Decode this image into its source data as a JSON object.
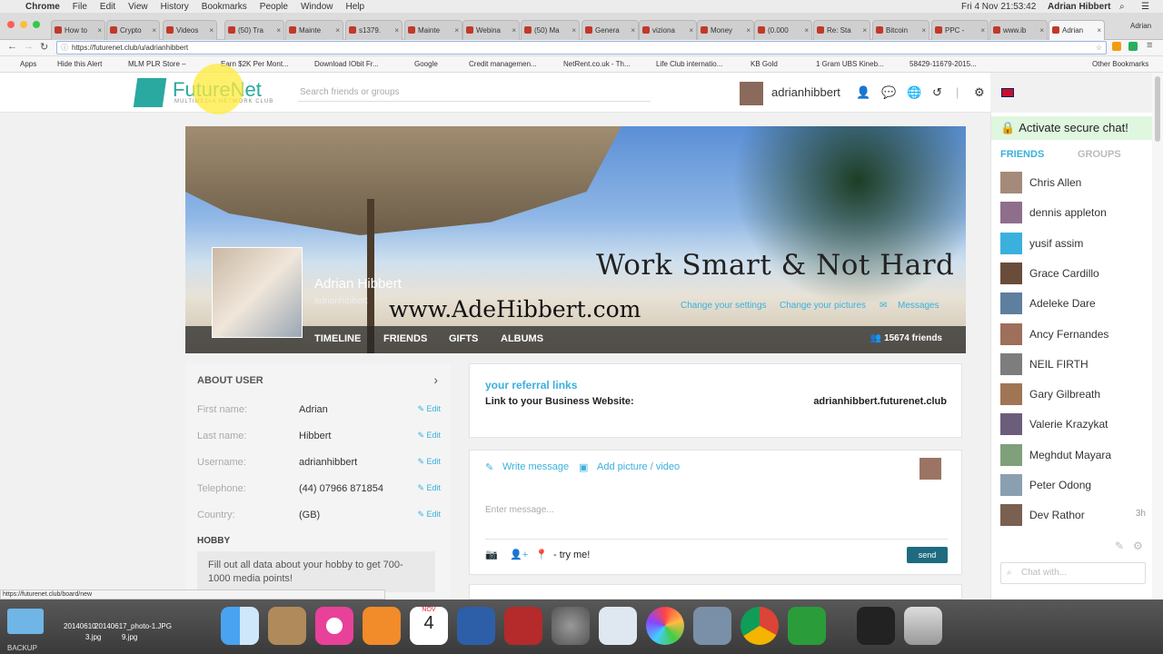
{
  "menubar": {
    "app": "Chrome",
    "items": [
      "File",
      "Edit",
      "View",
      "History",
      "Bookmarks",
      "People",
      "Window",
      "Help"
    ],
    "clock": "Fri 4 Nov  21:53:42",
    "user": "Adrian Hibbert"
  },
  "tabs": [
    {
      "label": "How to"
    },
    {
      "label": "Crypto"
    },
    {
      "label": "Videos"
    },
    {
      "label": "(50) Tra"
    },
    {
      "label": "Mainte"
    },
    {
      "label": "s1379."
    },
    {
      "label": "Mainte"
    },
    {
      "label": "Webina"
    },
    {
      "label": "(50) Ma"
    },
    {
      "label": "Genera"
    },
    {
      "label": "viziona"
    },
    {
      "label": "Money"
    },
    {
      "label": "(0.000"
    },
    {
      "label": "Re: Sta"
    },
    {
      "label": "Bitcoin"
    },
    {
      "label": "PPC -"
    },
    {
      "label": "www.ib"
    },
    {
      "label": "Adrian"
    }
  ],
  "window_user_tab": "Adrian",
  "address": {
    "url": "https://futurenet.club/u/adrianhibbert"
  },
  "bookmarks": [
    "Apps",
    "Hide this Alert",
    "MLM PLR Store –",
    "Earn $2K Per Mont...",
    "Download IObit Fr...",
    "Google",
    "Credit managemen...",
    "NetRent.co.uk - Th...",
    "Life Club internatio...",
    "KB Gold",
    "1 Gram UBS Kineb...",
    "58429-11679-2015...",
    "Other Bookmarks"
  ],
  "header": {
    "logo": "FutureNet",
    "logo_sub": "MULTIMEDIA NETWORK CLUB",
    "search_placeholder": "Search friends or groups",
    "username": "adrianhibbert"
  },
  "cover": {
    "tagline": "Work Smart & Not Hard",
    "website": "www.AdeHibbert.com",
    "profile_name": "Adrian Hibbert",
    "profile_username": "adrianhibbert",
    "links": {
      "settings": "Change your settings",
      "pictures": "Change your pictures",
      "messages": "Messages"
    },
    "nav": [
      "TIMELINE",
      "FRIENDS",
      "GIFTS",
      "ALBUMS"
    ],
    "friends_count": "15674 friends"
  },
  "about": {
    "title": "ABOUT USER",
    "edit_label": "Edit",
    "rows": [
      {
        "label": "First name:",
        "value": "Adrian"
      },
      {
        "label": "Last name:",
        "value": "Hibbert"
      },
      {
        "label": "Username:",
        "value": "adrianhibbert"
      },
      {
        "label": "Telephone:",
        "value": "(44) 07966 871854"
      },
      {
        "label": "Country:",
        "value": "(GB)"
      }
    ],
    "hobby_title": "HOBBY",
    "hobby_text": "Fill out all data about your hobby to get 700-1000 media points!"
  },
  "referral": {
    "title": "your referral links",
    "label": "Link to your Business Website:",
    "value": "adrianhibbert.futurenet.club"
  },
  "post": {
    "write_message": "Write message",
    "add_picture": "Add picture / video",
    "placeholder": "Enter message...",
    "try_me": "- try me!",
    "send": "send"
  },
  "chat": {
    "banner": "Activate secure chat!",
    "tab_friends": "FRIENDS",
    "tab_groups": "GROUPS",
    "friends": [
      {
        "name": "Chris Allen",
        "time": ""
      },
      {
        "name": "dennis appleton",
        "time": ""
      },
      {
        "name": "yusif assim",
        "time": ""
      },
      {
        "name": "Grace Cardillo",
        "time": ""
      },
      {
        "name": "Adeleke Dare",
        "time": ""
      },
      {
        "name": "Ancy Fernandes",
        "time": ""
      },
      {
        "name": "NEIL FIRTH",
        "time": ""
      },
      {
        "name": "Gary Gilbreath",
        "time": ""
      },
      {
        "name": "Valerie Krazykat",
        "time": ""
      },
      {
        "name": "Meghdut Mayara",
        "time": ""
      },
      {
        "name": "Peter Odong",
        "time": ""
      },
      {
        "name": "Dev Rathor",
        "time": "3h"
      }
    ],
    "search_placeholder": "Chat with..."
  },
  "status_bar": "https://futurenet.club/board/new",
  "desktop": {
    "files": [
      "20140610",
      "20140617_photo-1.JPG",
      "9.jpg",
      "3.jpg"
    ],
    "backup_label": "BACKUP"
  },
  "dock_calendar": {
    "month": "NOV",
    "day": "4"
  },
  "colors": {
    "accent": "#3ab0dd",
    "brand": "#2aa9a0",
    "send": "#1e6b80"
  }
}
